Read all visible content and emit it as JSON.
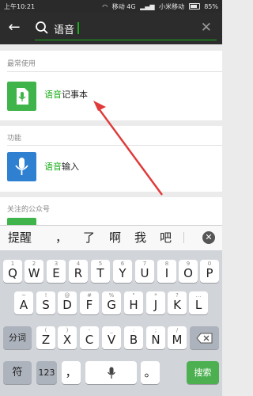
{
  "statusbar": {
    "time": "上午10:21",
    "network": "移动 4G",
    "carrier": "小米移动",
    "battery": "85%"
  },
  "search": {
    "query": "语音"
  },
  "sections": {
    "frequent": {
      "title": "最常使用",
      "item_highlight": "语音",
      "item_rest": "记事本"
    },
    "functions": {
      "title": "功能",
      "item_highlight": "语音",
      "item_rest": "输入"
    },
    "official": {
      "title": "关注的公众号"
    }
  },
  "candidates": [
    "提醒",
    "，",
    "了",
    "啊",
    "我",
    "吧"
  ],
  "keyboard": {
    "row1": [
      {
        "sub": "1",
        "main": "Q"
      },
      {
        "sub": "2",
        "main": "W"
      },
      {
        "sub": "3",
        "main": "E"
      },
      {
        "sub": "4",
        "main": "R"
      },
      {
        "sub": "5",
        "main": "T"
      },
      {
        "sub": "6",
        "main": "Y"
      },
      {
        "sub": "7",
        "main": "U"
      },
      {
        "sub": "8",
        "main": "I"
      },
      {
        "sub": "9",
        "main": "O"
      },
      {
        "sub": "0",
        "main": "P"
      }
    ],
    "row2": [
      {
        "sub": "~",
        "main": "A"
      },
      {
        "sub": "!",
        "main": "S"
      },
      {
        "sub": "@",
        "main": "D"
      },
      {
        "sub": "#",
        "main": "F"
      },
      {
        "sub": "%",
        "main": "G"
      },
      {
        "sub": "\"",
        "main": "H"
      },
      {
        "sub": "*",
        "main": "J"
      },
      {
        "sub": "?",
        "main": "K"
      },
      {
        "sub": "…",
        "main": "L"
      }
    ],
    "row3": [
      {
        "sub": "(",
        "main": "Z"
      },
      {
        "sub": ")",
        "main": "X"
      },
      {
        "sub": "-",
        "main": "C"
      },
      {
        "sub": "_",
        "main": "V"
      },
      {
        "sub": ":",
        "main": "B"
      },
      {
        "sub": ";",
        "main": "N"
      },
      {
        "sub": "/",
        "main": "M"
      }
    ],
    "split_label": "分词",
    "symbol_label": "符",
    "num_label": "123",
    "comma_label": "，",
    "period_label": "。",
    "search_label": "搜索"
  },
  "colors": {
    "accent": "#1aad19",
    "topbar": "#2c2c2c",
    "voice_icon_green": "#3fb44a",
    "voice_icon_blue": "#2f80d1",
    "arrow_red": "#e03a3a"
  }
}
